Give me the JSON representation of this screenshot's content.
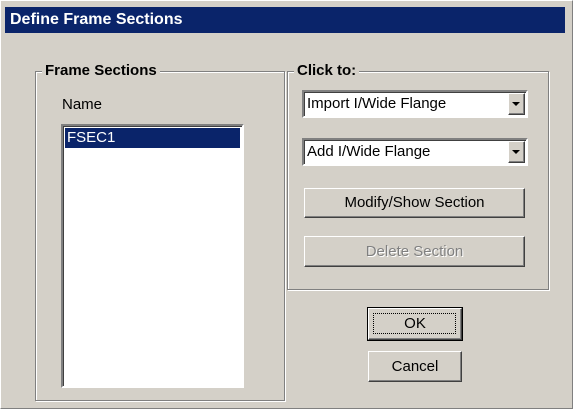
{
  "window": {
    "title": "Define Frame Sections"
  },
  "frame_sections": {
    "legend": "Frame Sections",
    "name_label": "Name",
    "items": [
      "FSEC1"
    ]
  },
  "click_to": {
    "legend": "Click to:",
    "import_select": "Import I/Wide Flange",
    "add_select": "Add I/Wide Flange",
    "modify_button": "Modify/Show Section",
    "delete_button": "Delete Section"
  },
  "buttons": {
    "ok": "OK",
    "cancel": "Cancel"
  },
  "colors": {
    "face": "#d4d0c8",
    "titlebar": "#0a246a",
    "selection": "#0a246a"
  }
}
